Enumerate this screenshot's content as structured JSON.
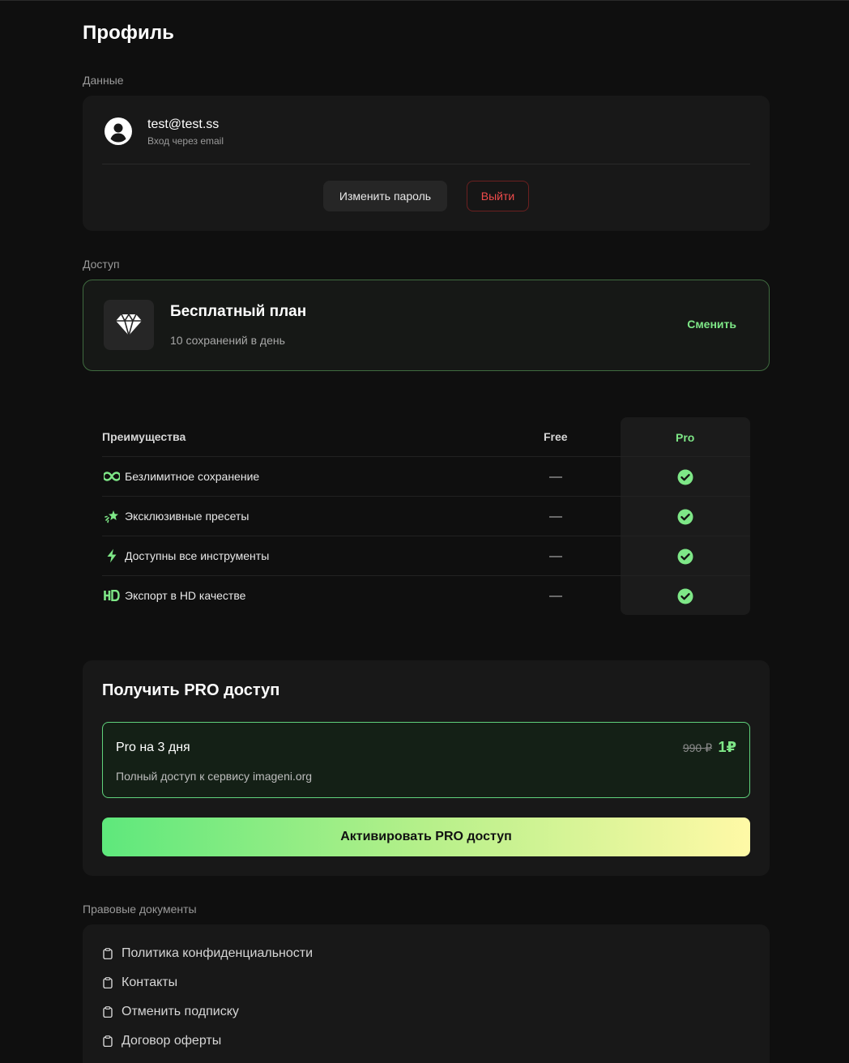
{
  "page": {
    "title": "Профиль"
  },
  "data_section": {
    "label": "Данные",
    "email": "test@test.ss",
    "login_method": "Вход через email",
    "change_password_label": "Изменить пароль",
    "logout_label": "Выйти"
  },
  "access_section": {
    "label": "Доступ",
    "plan_title": "Бесплатный план",
    "plan_subtitle": "10 сохранений в день",
    "change_label": "Сменить"
  },
  "benefits": {
    "header": {
      "feature": "Преимущества",
      "free": "Free",
      "pro": "Pro"
    },
    "rows": [
      {
        "label": "Безлимитное сохранение",
        "icon": "infinity-icon",
        "free": "—",
        "pro": "check"
      },
      {
        "label": "Эксклюзивные пресеты",
        "icon": "sparkle-star-icon",
        "free": "—",
        "pro": "check"
      },
      {
        "label": "Доступны все инструменты",
        "icon": "lightning-icon",
        "free": "—",
        "pro": "check"
      },
      {
        "label": "Экспорт в HD качестве",
        "icon": "hd-icon",
        "free": "—",
        "pro": "check"
      }
    ]
  },
  "pro_offer": {
    "title": "Получить PRO доступ",
    "plan_name": "Pro на 3 дня",
    "plan_description": "Полный доступ к сервису imageni.org",
    "old_price": "990 ₽",
    "new_price": "1₽",
    "activate_label": "Активировать PRO доступ"
  },
  "legal": {
    "label": "Правовые документы",
    "items": [
      "Политика конфиденциальности",
      "Контакты",
      "Отменить подписку",
      "Договор оферты"
    ]
  },
  "colors": {
    "background": "#0f0f0f",
    "card": "#181818",
    "accent_green": "#7ee787",
    "danger_red": "#f04b4b",
    "gradient_start": "#5ee87c",
    "gradient_end": "#fff9a6"
  }
}
